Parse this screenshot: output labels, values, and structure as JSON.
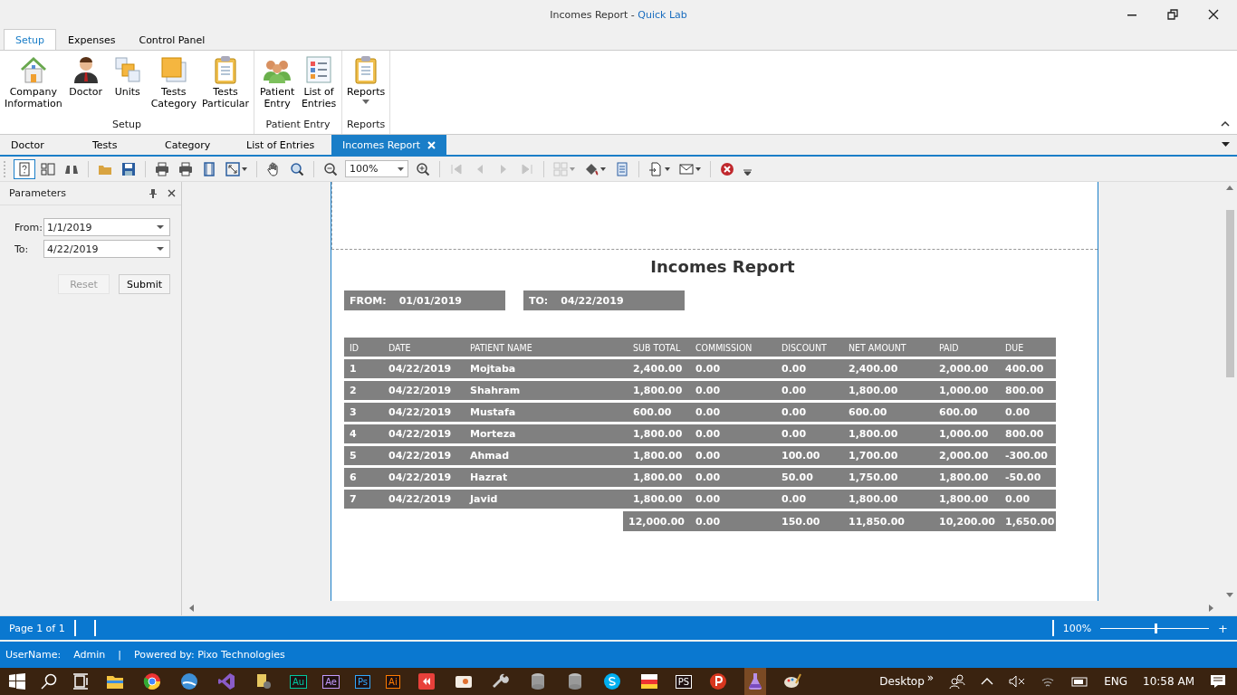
{
  "window": {
    "title": "Incomes Report - ",
    "app_name": "Quick Lab"
  },
  "ribbon_tabs": [
    {
      "label": "Setup",
      "selected": true
    },
    {
      "label": "Expenses",
      "selected": false
    },
    {
      "label": "Control Panel",
      "selected": false
    }
  ],
  "ribbon_groups": [
    {
      "label": "Setup",
      "buttons": [
        {
          "kind": "house",
          "label": "Company Information"
        },
        {
          "kind": "person",
          "label": "Doctor"
        },
        {
          "kind": "squares",
          "label": "Units"
        },
        {
          "kind": "square",
          "label": "Tests Category"
        },
        {
          "kind": "clipboard",
          "label": "Tests Particular"
        }
      ]
    },
    {
      "label": "Patient Entry",
      "buttons": [
        {
          "kind": "people",
          "label": "Patient Entry"
        },
        {
          "kind": "list",
          "label": "List of Entries"
        }
      ]
    },
    {
      "label": "Reports",
      "buttons": [
        {
          "kind": "clipboard",
          "label": "Reports",
          "dropdown": true
        }
      ]
    }
  ],
  "doc_tabs": [
    {
      "label": "Doctor",
      "selected": false
    },
    {
      "label": "Tests",
      "selected": false
    },
    {
      "label": "Category",
      "selected": false
    },
    {
      "label": "List of Entries",
      "selected": false
    },
    {
      "label": "Incomes Report",
      "selected": true
    }
  ],
  "toolbar": [
    {
      "kind": "help",
      "selected": true
    },
    {
      "kind": "panel"
    },
    {
      "kind": "binoculars"
    },
    {
      "kind": "sep"
    },
    {
      "kind": "folder"
    },
    {
      "kind": "save"
    },
    {
      "kind": "sep"
    },
    {
      "kind": "print"
    },
    {
      "kind": "print"
    },
    {
      "kind": "page"
    },
    {
      "kind": "resize",
      "dropdown": true
    },
    {
      "kind": "sep"
    },
    {
      "kind": "hand"
    },
    {
      "kind": "magnifier"
    },
    {
      "kind": "sep"
    },
    {
      "kind": "zoom-out"
    },
    {
      "kind": "zoom-box",
      "value": "100%"
    },
    {
      "kind": "zoom-in"
    },
    {
      "kind": "sep"
    },
    {
      "kind": "first",
      "disabled": true
    },
    {
      "kind": "prev",
      "disabled": true
    },
    {
      "kind": "next",
      "disabled": true
    },
    {
      "kind": "last",
      "disabled": true
    },
    {
      "kind": "sep"
    },
    {
      "kind": "grid",
      "disabled": true,
      "dropdown": true
    },
    {
      "kind": "paint",
      "dropdown": true
    },
    {
      "kind": "document"
    },
    {
      "kind": "sep"
    },
    {
      "kind": "export",
      "dropdown": true
    },
    {
      "kind": "mail",
      "dropdown": true
    },
    {
      "kind": "sep"
    },
    {
      "kind": "close-circle"
    }
  ],
  "parameters": {
    "title": "Parameters",
    "fields": [
      {
        "label": "From:",
        "value": "1/1/2019"
      },
      {
        "label": "To:",
        "value": "4/22/2019"
      }
    ],
    "buttons": [
      {
        "label": "Reset",
        "disabled": true
      },
      {
        "label": "Submit",
        "disabled": false
      }
    ]
  },
  "report": {
    "title": "Incomes Report",
    "from_label": "FROM:",
    "from": "01/01/2019",
    "to_label": "TO:",
    "to": "04/22/2019",
    "columns": [
      "ID",
      "DATE",
      "PATIENT NAME",
      "SUB TOTAL",
      "COMMISSION",
      "DISCOUNT",
      "NET AMOUNT",
      "PAID",
      "DUE"
    ],
    "rows": [
      [
        "1",
        "04/22/2019",
        "Mojtaba",
        "2,400.00",
        "0.00",
        "0.00",
        "2,400.00",
        "2,000.00",
        "400.00"
      ],
      [
        "2",
        "04/22/2019",
        "Shahram",
        "1,800.00",
        "0.00",
        "0.00",
        "1,800.00",
        "1,000.00",
        "800.00"
      ],
      [
        "3",
        "04/22/2019",
        "Mustafa",
        "600.00",
        "0.00",
        "0.00",
        "600.00",
        "600.00",
        "0.00"
      ],
      [
        "4",
        "04/22/2019",
        "Morteza",
        "1,800.00",
        "0.00",
        "0.00",
        "1,800.00",
        "1,000.00",
        "800.00"
      ],
      [
        "5",
        "04/22/2019",
        "Ahmad",
        "1,800.00",
        "0.00",
        "100.00",
        "1,700.00",
        "2,000.00",
        "-300.00"
      ],
      [
        "6",
        "04/22/2019",
        "Hazrat",
        "1,800.00",
        "0.00",
        "50.00",
        "1,750.00",
        "1,800.00",
        "-50.00"
      ],
      [
        "7",
        "04/22/2019",
        "Javid",
        "1,800.00",
        "0.00",
        "0.00",
        "1,800.00",
        "1,800.00",
        "0.00"
      ]
    ],
    "totals": [
      "12,000.00",
      "0.00",
      "150.00",
      "11,850.00",
      "10,200.00",
      "1,650.00"
    ]
  },
  "status_bar": {
    "page": "Page 1 of 1",
    "zoom": "100%",
    "zoom_slider": {
      "level": 0.5
    },
    "plus": "+"
  },
  "user_bar": {
    "user_label": "UserName:",
    "user": "Admin",
    "separator": "|",
    "powered": "Powered by: Pixo Technologies"
  },
  "taskbar": {
    "apps": [
      {
        "kind": "explorer",
        "active": false
      },
      {
        "kind": "chrome",
        "active": false
      },
      {
        "kind": "orb",
        "active": false
      },
      {
        "kind": "vs",
        "active": false
      },
      {
        "kind": "tool",
        "active": false
      },
      {
        "kind": "tile",
        "label": "Au",
        "color": "#00c8a0"
      },
      {
        "kind": "tile",
        "label": "Ae",
        "color": "#c39bff"
      },
      {
        "kind": "tile",
        "label": "Ps",
        "color": "#31a8ff"
      },
      {
        "kind": "tile",
        "label": "Ai",
        "color": "#ff7c00"
      },
      {
        "kind": "red",
        "active": false
      },
      {
        "kind": "photo",
        "active": false
      },
      {
        "kind": "wrench",
        "active": false
      },
      {
        "kind": "db",
        "active": false
      },
      {
        "kind": "db",
        "active": false
      },
      {
        "kind": "skype",
        "active": false
      },
      {
        "kind": "flag",
        "active": false
      },
      {
        "kind": "tile",
        "label": "PS",
        "color": "#ffffff"
      },
      {
        "kind": "p",
        "active": false
      },
      {
        "kind": "flask",
        "active": true
      },
      {
        "kind": "palette",
        "active": false
      }
    ],
    "desktop": "Desktop",
    "chevron": "»",
    "lang": "ENG",
    "time": "10:58 AM"
  }
}
